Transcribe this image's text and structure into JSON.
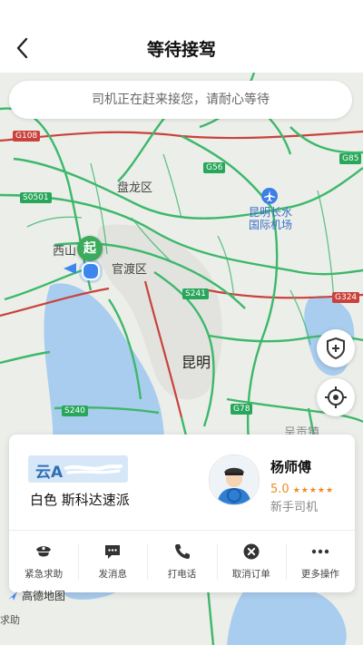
{
  "header": {
    "title": "等待接驾",
    "back_icon": "chevron-left-icon"
  },
  "banner": {
    "text": "司机正在赶来接您，请耐心等待"
  },
  "map": {
    "road_labels": [
      "G108",
      "S0501",
      "G56",
      "G85",
      "S241",
      "G324",
      "S240",
      "G78"
    ],
    "places": [
      "盘龙区",
      "西山",
      "官渡区",
      "昆明",
      "呈贡镇"
    ],
    "airport": "昆明长水\n国际机场",
    "start_marker": "起",
    "shield_button_icon": "shield-plus-icon",
    "locate_button_icon": "crosshair-icon"
  },
  "driver": {
    "plate_prefix": "云A",
    "car": "白色 斯科达速派",
    "name": "杨师傅",
    "rating": "5.0",
    "stars": "★★★★★",
    "tag": "新手司机"
  },
  "actions": [
    {
      "label": "紧急求助",
      "icon": "police-cap-icon"
    },
    {
      "label": "发消息",
      "icon": "chat-bubble-icon"
    },
    {
      "label": "打电话",
      "icon": "phone-icon"
    },
    {
      "label": "取消订单",
      "icon": "cancel-circle-icon"
    },
    {
      "label": "更多操作",
      "icon": "more-dots-icon"
    }
  ],
  "footer": {
    "map_brand": "高德地图",
    "help": "求助"
  },
  "colors": {
    "road_green": "#3cb86a",
    "road_red": "#c9423b",
    "accent_orange": "#f08b1e",
    "water_blue": "#a9cdee"
  }
}
